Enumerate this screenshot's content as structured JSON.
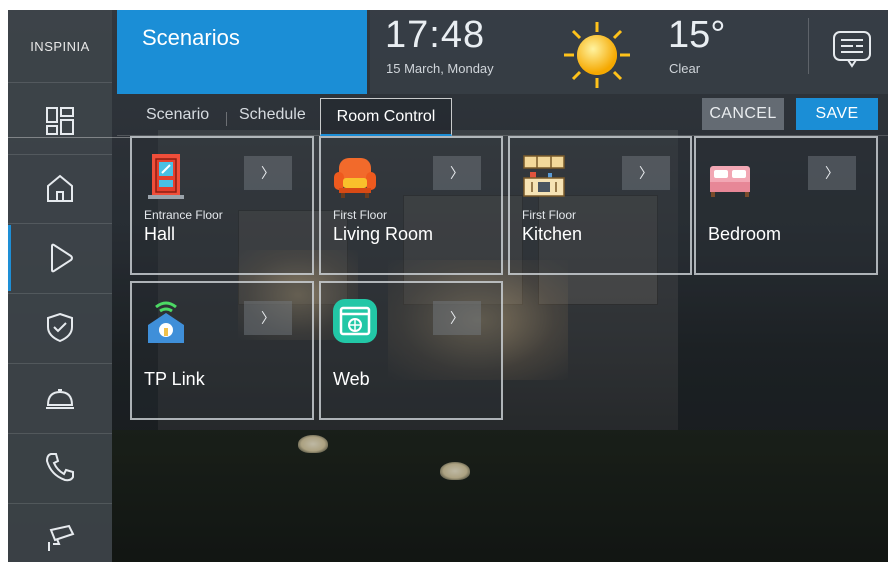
{
  "sidebar": {
    "logo_text": "INSPINIA",
    "items": [
      {
        "icon": "dashboard-icon"
      },
      {
        "icon": "home-icon"
      },
      {
        "icon": "scenario-play-icon"
      },
      {
        "icon": "shield-check-icon"
      },
      {
        "icon": "service-bell-icon"
      },
      {
        "icon": "phone-icon"
      },
      {
        "icon": "security-camera-icon"
      }
    ]
  },
  "header": {
    "title": "Scenarios",
    "time": "17:48",
    "date": "15 March, Monday",
    "weather_icon": "sun-icon",
    "temperature": "15°",
    "condition": "Clear",
    "message_icon": "message-icon"
  },
  "tabs": [
    {
      "label": "Scenario"
    },
    {
      "label": "Schedule"
    },
    {
      "label": "Room Control"
    }
  ],
  "actions": {
    "cancel": "CANCEL",
    "save": "SAVE"
  },
  "tiles": [
    {
      "floor": "Entrance Floor",
      "name": "Hall",
      "icon": "door-icon",
      "arrow": "〉"
    },
    {
      "floor": "First Floor",
      "name": "Living Room",
      "icon": "armchair-icon",
      "arrow": "〉"
    },
    {
      "floor": "First Floor",
      "name": "Kitchen",
      "icon": "kitchen-icon",
      "arrow": "〉"
    },
    {
      "floor": "",
      "name": "Bedroom",
      "icon": "bed-icon",
      "arrow": "〉"
    },
    {
      "floor": "",
      "name": "TP Link",
      "icon": "smart-home-icon",
      "arrow": "〉"
    },
    {
      "floor": "",
      "name": "Web",
      "icon": "web-icon",
      "arrow": "〉"
    }
  ],
  "colors": {
    "accent": "#1b8ed6",
    "header_bar": "#3a4148",
    "sidebar": "#3e444a"
  }
}
